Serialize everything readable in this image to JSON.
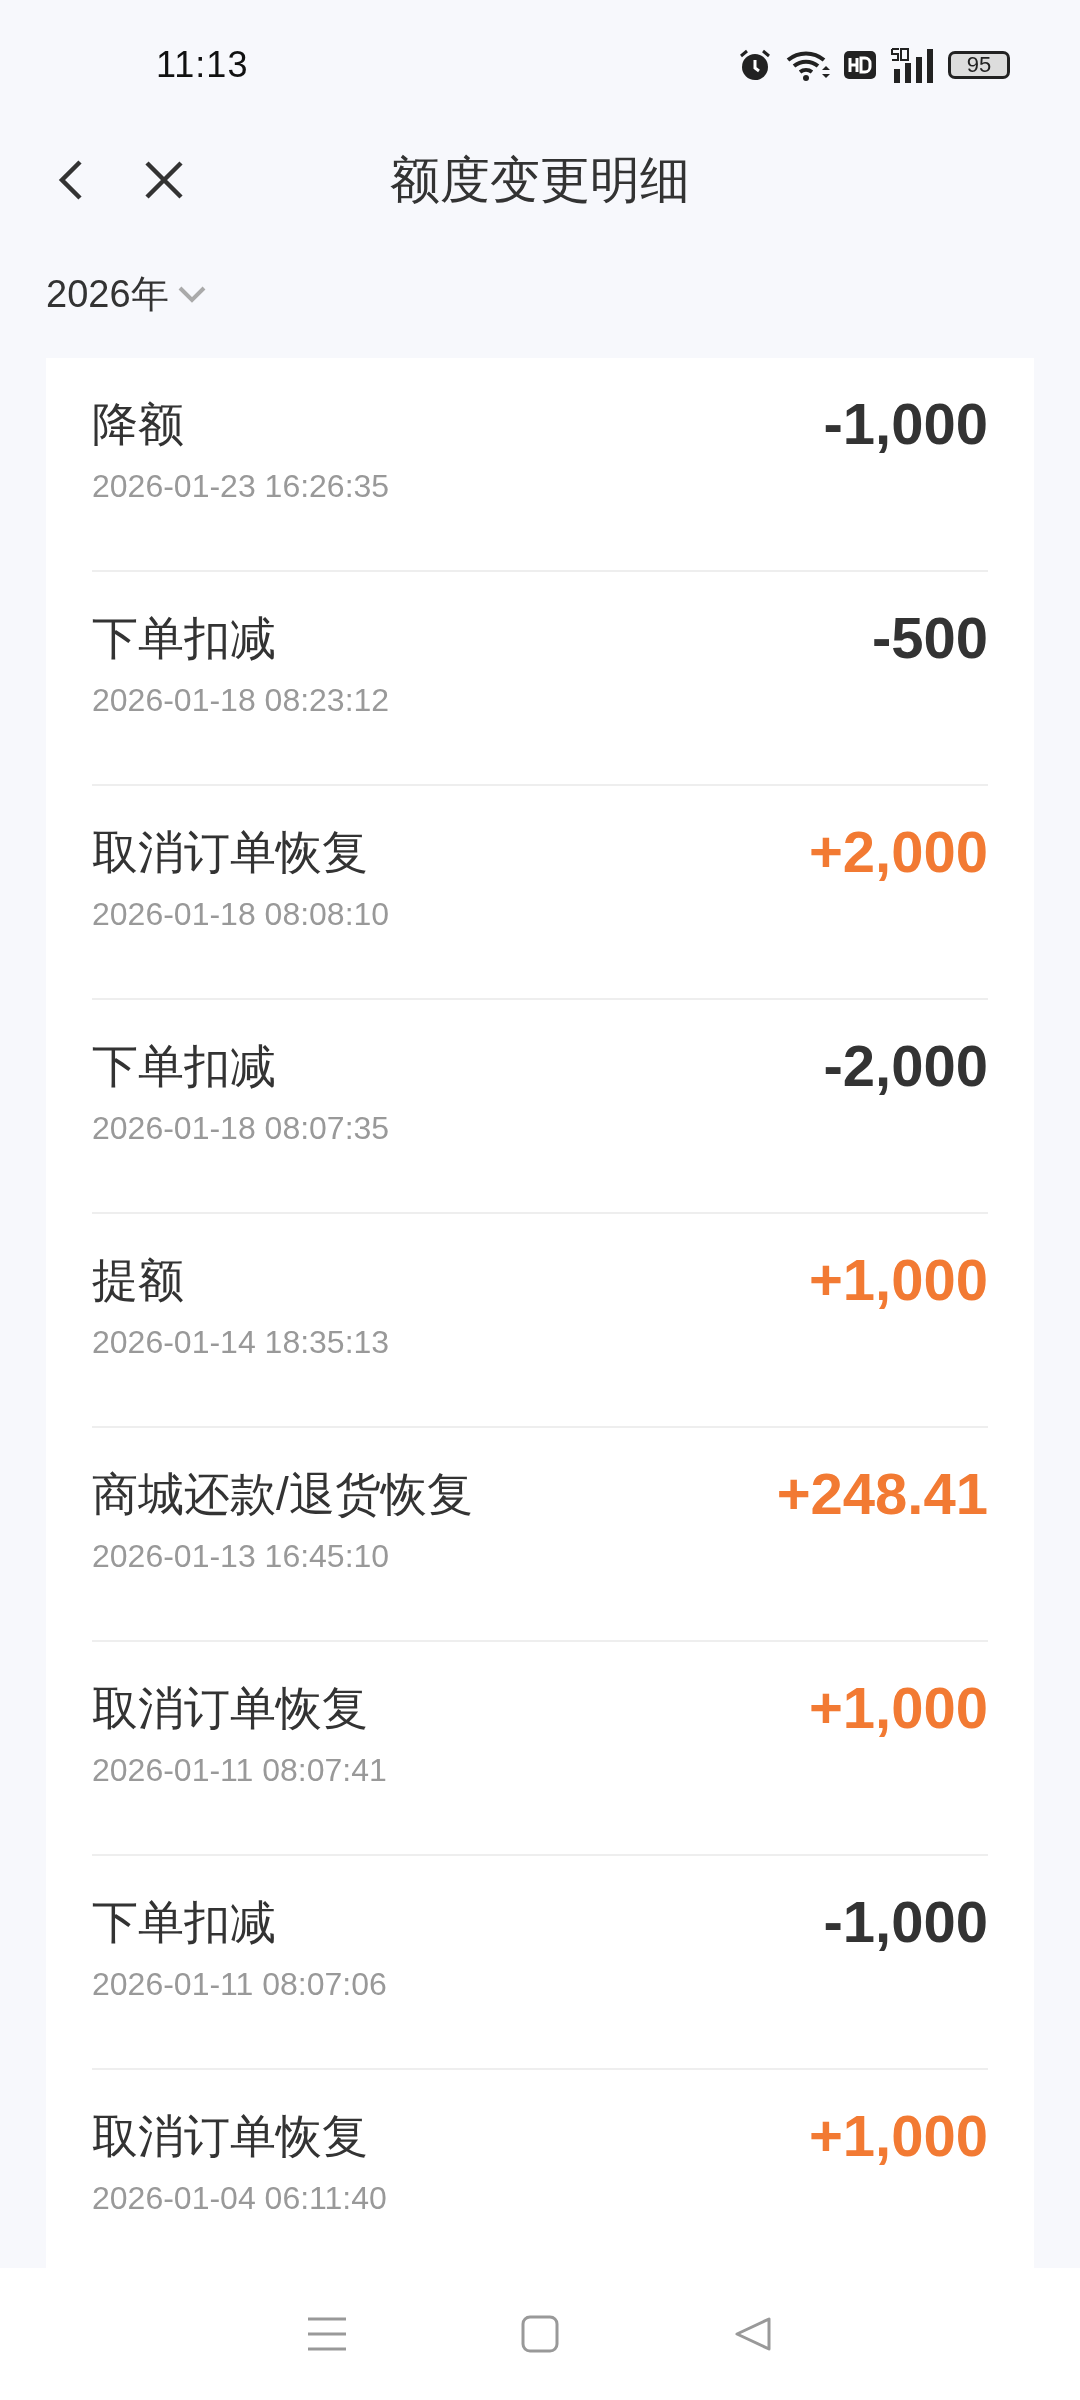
{
  "status_bar": {
    "time": "11:13",
    "battery": "95"
  },
  "header": {
    "title": "额度变更明细"
  },
  "year_filter": {
    "label": "2026年"
  },
  "records": [
    {
      "title": "降额",
      "time": "2026-01-23 16:26:35",
      "amount": "-1,000",
      "color": "#333333"
    },
    {
      "title": "下单扣减",
      "time": "2026-01-18 08:23:12",
      "amount": "-500",
      "color": "#333333"
    },
    {
      "title": "取消订单恢复",
      "time": "2026-01-18 08:08:10",
      "amount": "+2,000",
      "color": "#f27a33"
    },
    {
      "title": "下单扣减",
      "time": "2026-01-18 08:07:35",
      "amount": "-2,000",
      "color": "#333333"
    },
    {
      "title": "提额",
      "time": "2026-01-14 18:35:13",
      "amount": "+1,000",
      "color": "#f27a33"
    },
    {
      "title": "商城还款/退货恢复",
      "time": "2026-01-13 16:45:10",
      "amount": "+248.41",
      "color": "#f27a33"
    },
    {
      "title": "取消订单恢复",
      "time": "2026-01-11 08:07:41",
      "amount": "+1,000",
      "color": "#f27a33"
    },
    {
      "title": "下单扣减",
      "time": "2026-01-11 08:07:06",
      "amount": "-1,000",
      "color": "#333333"
    },
    {
      "title": "取消订单恢复",
      "time": "2026-01-04 06:11:40",
      "amount": "+1,000",
      "color": "#f27a33"
    }
  ]
}
